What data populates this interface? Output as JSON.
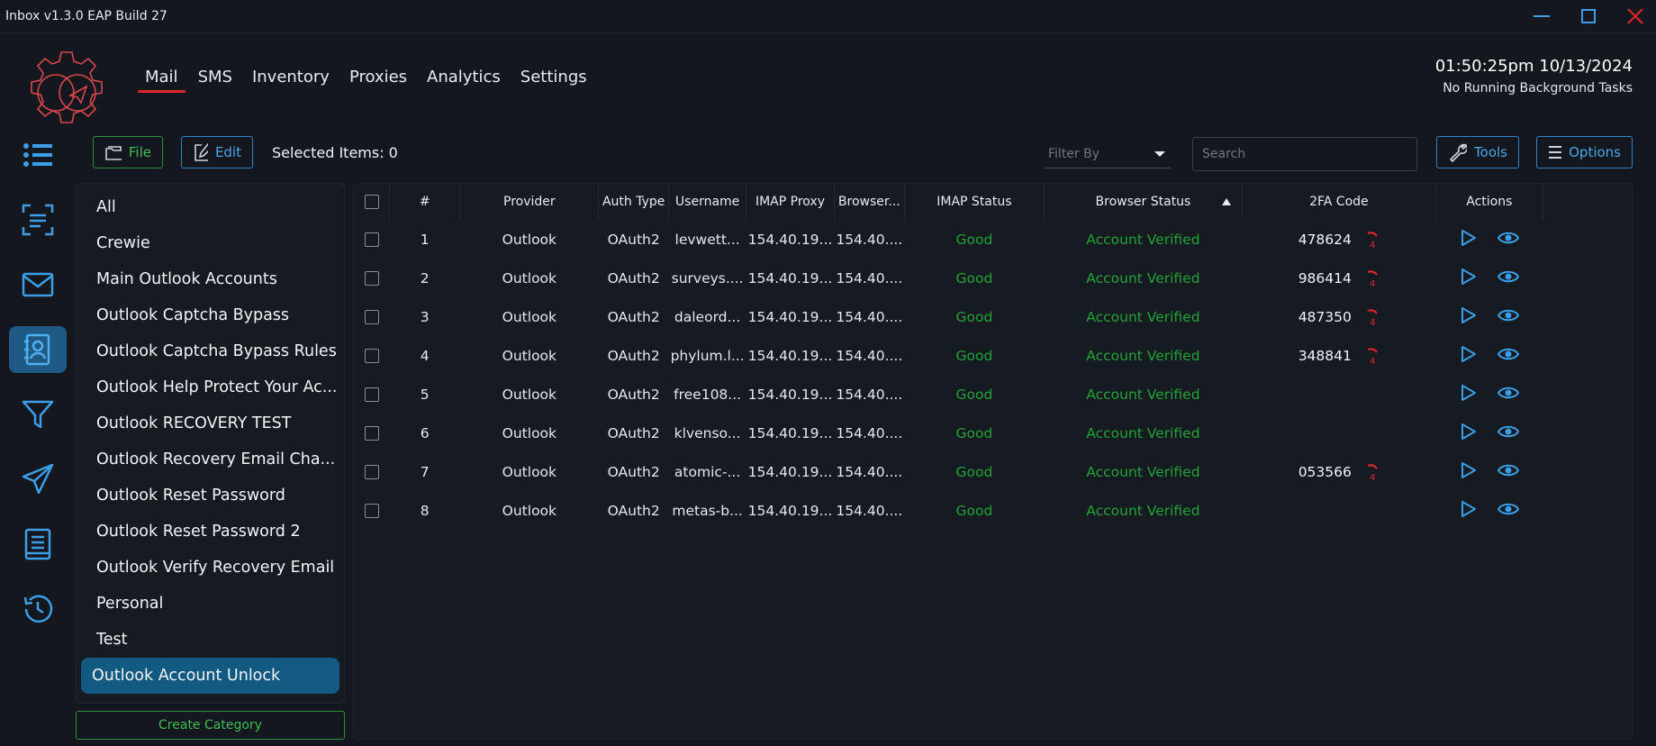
{
  "window": {
    "title": "Inbox v1.3.0 EAP Build 27"
  },
  "nav": {
    "items": [
      "Mail",
      "SMS",
      "Inventory",
      "Proxies",
      "Analytics",
      "Settings"
    ],
    "active": "Mail"
  },
  "clock": {
    "time": "01:50:25pm 10/13/2024",
    "status": "No Running Background Tasks"
  },
  "sidebar_icons": [
    "list-icon",
    "scan-text-icon",
    "mail-icon",
    "contacts-icon",
    "filter-icon",
    "send-icon",
    "book-icon",
    "history-icon"
  ],
  "toolbar": {
    "file_label": "File",
    "edit_label": "Edit",
    "selected_items": "Selected Items: 0",
    "filter_placeholder": "Filter By",
    "search_placeholder": "Search",
    "tools_label": "Tools",
    "options_label": "Options"
  },
  "categories": {
    "items": [
      "All",
      "Crewie",
      "Main Outlook Accounts",
      "Outlook Captcha Bypass",
      "Outlook Captcha Bypass Rules",
      "Outlook Help Protect Your Ac...",
      "Outlook RECOVERY TEST",
      "Outlook Recovery Email Cha...",
      "Outlook Reset Password",
      "Outlook Reset Password 2",
      "Outlook Verify Recovery Email",
      "Personal",
      "Test",
      "Outlook Account Unlock"
    ],
    "active": "Outlook Account Unlock",
    "create_label": "Create Category"
  },
  "table": {
    "columns": [
      "#",
      "Provider",
      "Auth Type",
      "Username",
      "IMAP Proxy",
      "Browser...",
      "IMAP Status",
      "Browser Status",
      "2FA Code",
      "Actions"
    ],
    "rows": [
      {
        "n": "1",
        "provider": "Outlook",
        "auth": "OAuth2",
        "user": "levwett...",
        "imap_proxy": "154.40.19...",
        "browser": "154.40....",
        "imap_status": "Good",
        "browser_status": "Account Verified",
        "code": "478624"
      },
      {
        "n": "2",
        "provider": "Outlook",
        "auth": "OAuth2",
        "user": "surveys....",
        "imap_proxy": "154.40.19...",
        "browser": "154.40....",
        "imap_status": "Good",
        "browser_status": "Account Verified",
        "code": "986414"
      },
      {
        "n": "3",
        "provider": "Outlook",
        "auth": "OAuth2",
        "user": "daleord...",
        "imap_proxy": "154.40.19...",
        "browser": "154.40....",
        "imap_status": "Good",
        "browser_status": "Account Verified",
        "code": "487350"
      },
      {
        "n": "4",
        "provider": "Outlook",
        "auth": "OAuth2",
        "user": "phylum.l...",
        "imap_proxy": "154.40.19...",
        "browser": "154.40....",
        "imap_status": "Good",
        "browser_status": "Account Verified",
        "code": "348841"
      },
      {
        "n": "5",
        "provider": "Outlook",
        "auth": "OAuth2",
        "user": "free108...",
        "imap_proxy": "154.40.19...",
        "browser": "154.40....",
        "imap_status": "Good",
        "browser_status": "Account Verified",
        "code": ""
      },
      {
        "n": "6",
        "provider": "Outlook",
        "auth": "OAuth2",
        "user": "klvenso...",
        "imap_proxy": "154.40.19...",
        "browser": "154.40....",
        "imap_status": "Good",
        "browser_status": "Account Verified",
        "code": ""
      },
      {
        "n": "7",
        "provider": "Outlook",
        "auth": "OAuth2",
        "user": "atomic-...",
        "imap_proxy": "154.40.19...",
        "browser": "154.40....",
        "imap_status": "Good",
        "browser_status": "Account Verified",
        "code": "053566"
      },
      {
        "n": "8",
        "provider": "Outlook",
        "auth": "OAuth2",
        "user": "metas-b...",
        "imap_proxy": "154.40.19...",
        "browser": "154.40....",
        "imap_status": "Good",
        "browser_status": "Account Verified",
        "code": ""
      }
    ],
    "timer_label": "4"
  },
  "colors": {
    "accent_blue": "#2f83c6",
    "accent_green": "#2f8d3f",
    "status_green": "#22a336",
    "active_red": "#e0262b",
    "active_category": "#125a82"
  }
}
